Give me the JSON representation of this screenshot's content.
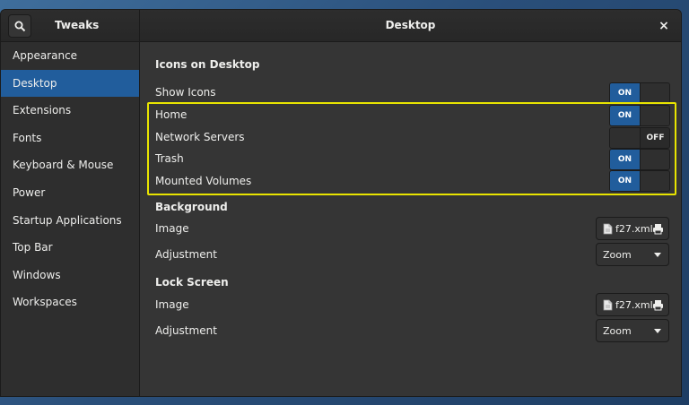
{
  "header": {
    "app_title": "Tweaks",
    "page_title": "Desktop",
    "close_glyph": "×"
  },
  "sidebar": {
    "items": [
      {
        "label": "Appearance"
      },
      {
        "label": "Desktop"
      },
      {
        "label": "Extensions"
      },
      {
        "label": "Fonts"
      },
      {
        "label": "Keyboard & Mouse"
      },
      {
        "label": "Power"
      },
      {
        "label": "Startup Applications"
      },
      {
        "label": "Top Bar"
      },
      {
        "label": "Windows"
      },
      {
        "label": "Workspaces"
      }
    ],
    "active_index": 1
  },
  "icons_section": {
    "title": "Icons on Desktop",
    "rows": [
      {
        "label": "Show Icons",
        "state": "ON"
      },
      {
        "label": "Home",
        "state": "ON"
      },
      {
        "label": "Network Servers",
        "state": "OFF"
      },
      {
        "label": "Trash",
        "state": "ON"
      },
      {
        "label": "Mounted Volumes",
        "state": "ON"
      }
    ]
  },
  "background_section": {
    "title": "Background",
    "image_label": "Image",
    "image_file": "f27.xml",
    "adjustment_label": "Adjustment",
    "adjustment_value": "Zoom"
  },
  "lockscreen_section": {
    "title": "Lock Screen",
    "image_label": "Image",
    "image_file": "f27.xml",
    "adjustment_label": "Adjustment",
    "adjustment_value": "Zoom"
  },
  "colors": {
    "accent": "#215d9c",
    "highlight": "#e8e400",
    "window_bg": "#353535",
    "sidebar_bg": "#2e2e2e"
  },
  "icons": [
    "search-icon",
    "close-icon",
    "document-icon",
    "printer-icon",
    "chevron-down-icon"
  ]
}
